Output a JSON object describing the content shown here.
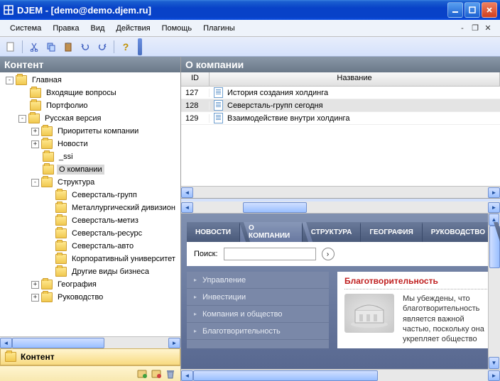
{
  "window": {
    "title": "DJEM - [demo@demo.djem.ru]"
  },
  "menu": {
    "items": [
      "Система",
      "Правка",
      "Вид",
      "Действия",
      "Помощь",
      "Плагины"
    ]
  },
  "left": {
    "header": "Контент",
    "accordion_label": "Контент",
    "tree": [
      {
        "level": 0,
        "exp": "-",
        "label": "Главная"
      },
      {
        "level": 1,
        "exp": "",
        "label": "Входящие вопросы"
      },
      {
        "level": 1,
        "exp": "",
        "label": "Портфолио"
      },
      {
        "level": 1,
        "exp": "-",
        "label": "Русская версия"
      },
      {
        "level": 2,
        "exp": "+",
        "label": "Приоритеты компании"
      },
      {
        "level": 2,
        "exp": "+",
        "label": "Новости"
      },
      {
        "level": 2,
        "exp": "",
        "label": "_ssi"
      },
      {
        "level": 2,
        "exp": "",
        "label": "О компании",
        "selected": true
      },
      {
        "level": 2,
        "exp": "-",
        "label": "Структура"
      },
      {
        "level": 3,
        "exp": "",
        "label": "Северсталь-групп"
      },
      {
        "level": 3,
        "exp": "",
        "label": "Металлургический дивизион"
      },
      {
        "level": 3,
        "exp": "",
        "label": "Северсталь-метиз"
      },
      {
        "level": 3,
        "exp": "",
        "label": "Северсталь-ресурс"
      },
      {
        "level": 3,
        "exp": "",
        "label": "Северсталь-авто"
      },
      {
        "level": 3,
        "exp": "",
        "label": "Корпоративный университет"
      },
      {
        "level": 3,
        "exp": "",
        "label": "Другие виды бизнеса"
      },
      {
        "level": 2,
        "exp": "+",
        "label": "География"
      },
      {
        "level": 2,
        "exp": "+",
        "label": "Руководство"
      }
    ]
  },
  "right": {
    "header": "О компании",
    "columns": {
      "id": "ID",
      "name": "Название"
    },
    "rows": [
      {
        "id": "127",
        "name": "История создания холдинга"
      },
      {
        "id": "128",
        "name": "Северсталь-групп сегодня",
        "selected": true
      },
      {
        "id": "129",
        "name": "Взаимодействие внутри холдинга"
      }
    ]
  },
  "preview": {
    "tabs": [
      "НОВОСТИ",
      "О КОМПАНИИ",
      "СТРУКТУРА",
      "ГЕОГРАФИЯ",
      "РУКОВОДСТВО"
    ],
    "active_tab": 1,
    "search_label": "Поиск:",
    "side_items": [
      "Управление",
      "Инвестиции",
      "Компания и общество",
      "Благотворительность"
    ],
    "heading": "Благотворительность",
    "body_text": "Мы убеждены, что благотворительность является важной частью, поскольку она укрепляет общество"
  }
}
